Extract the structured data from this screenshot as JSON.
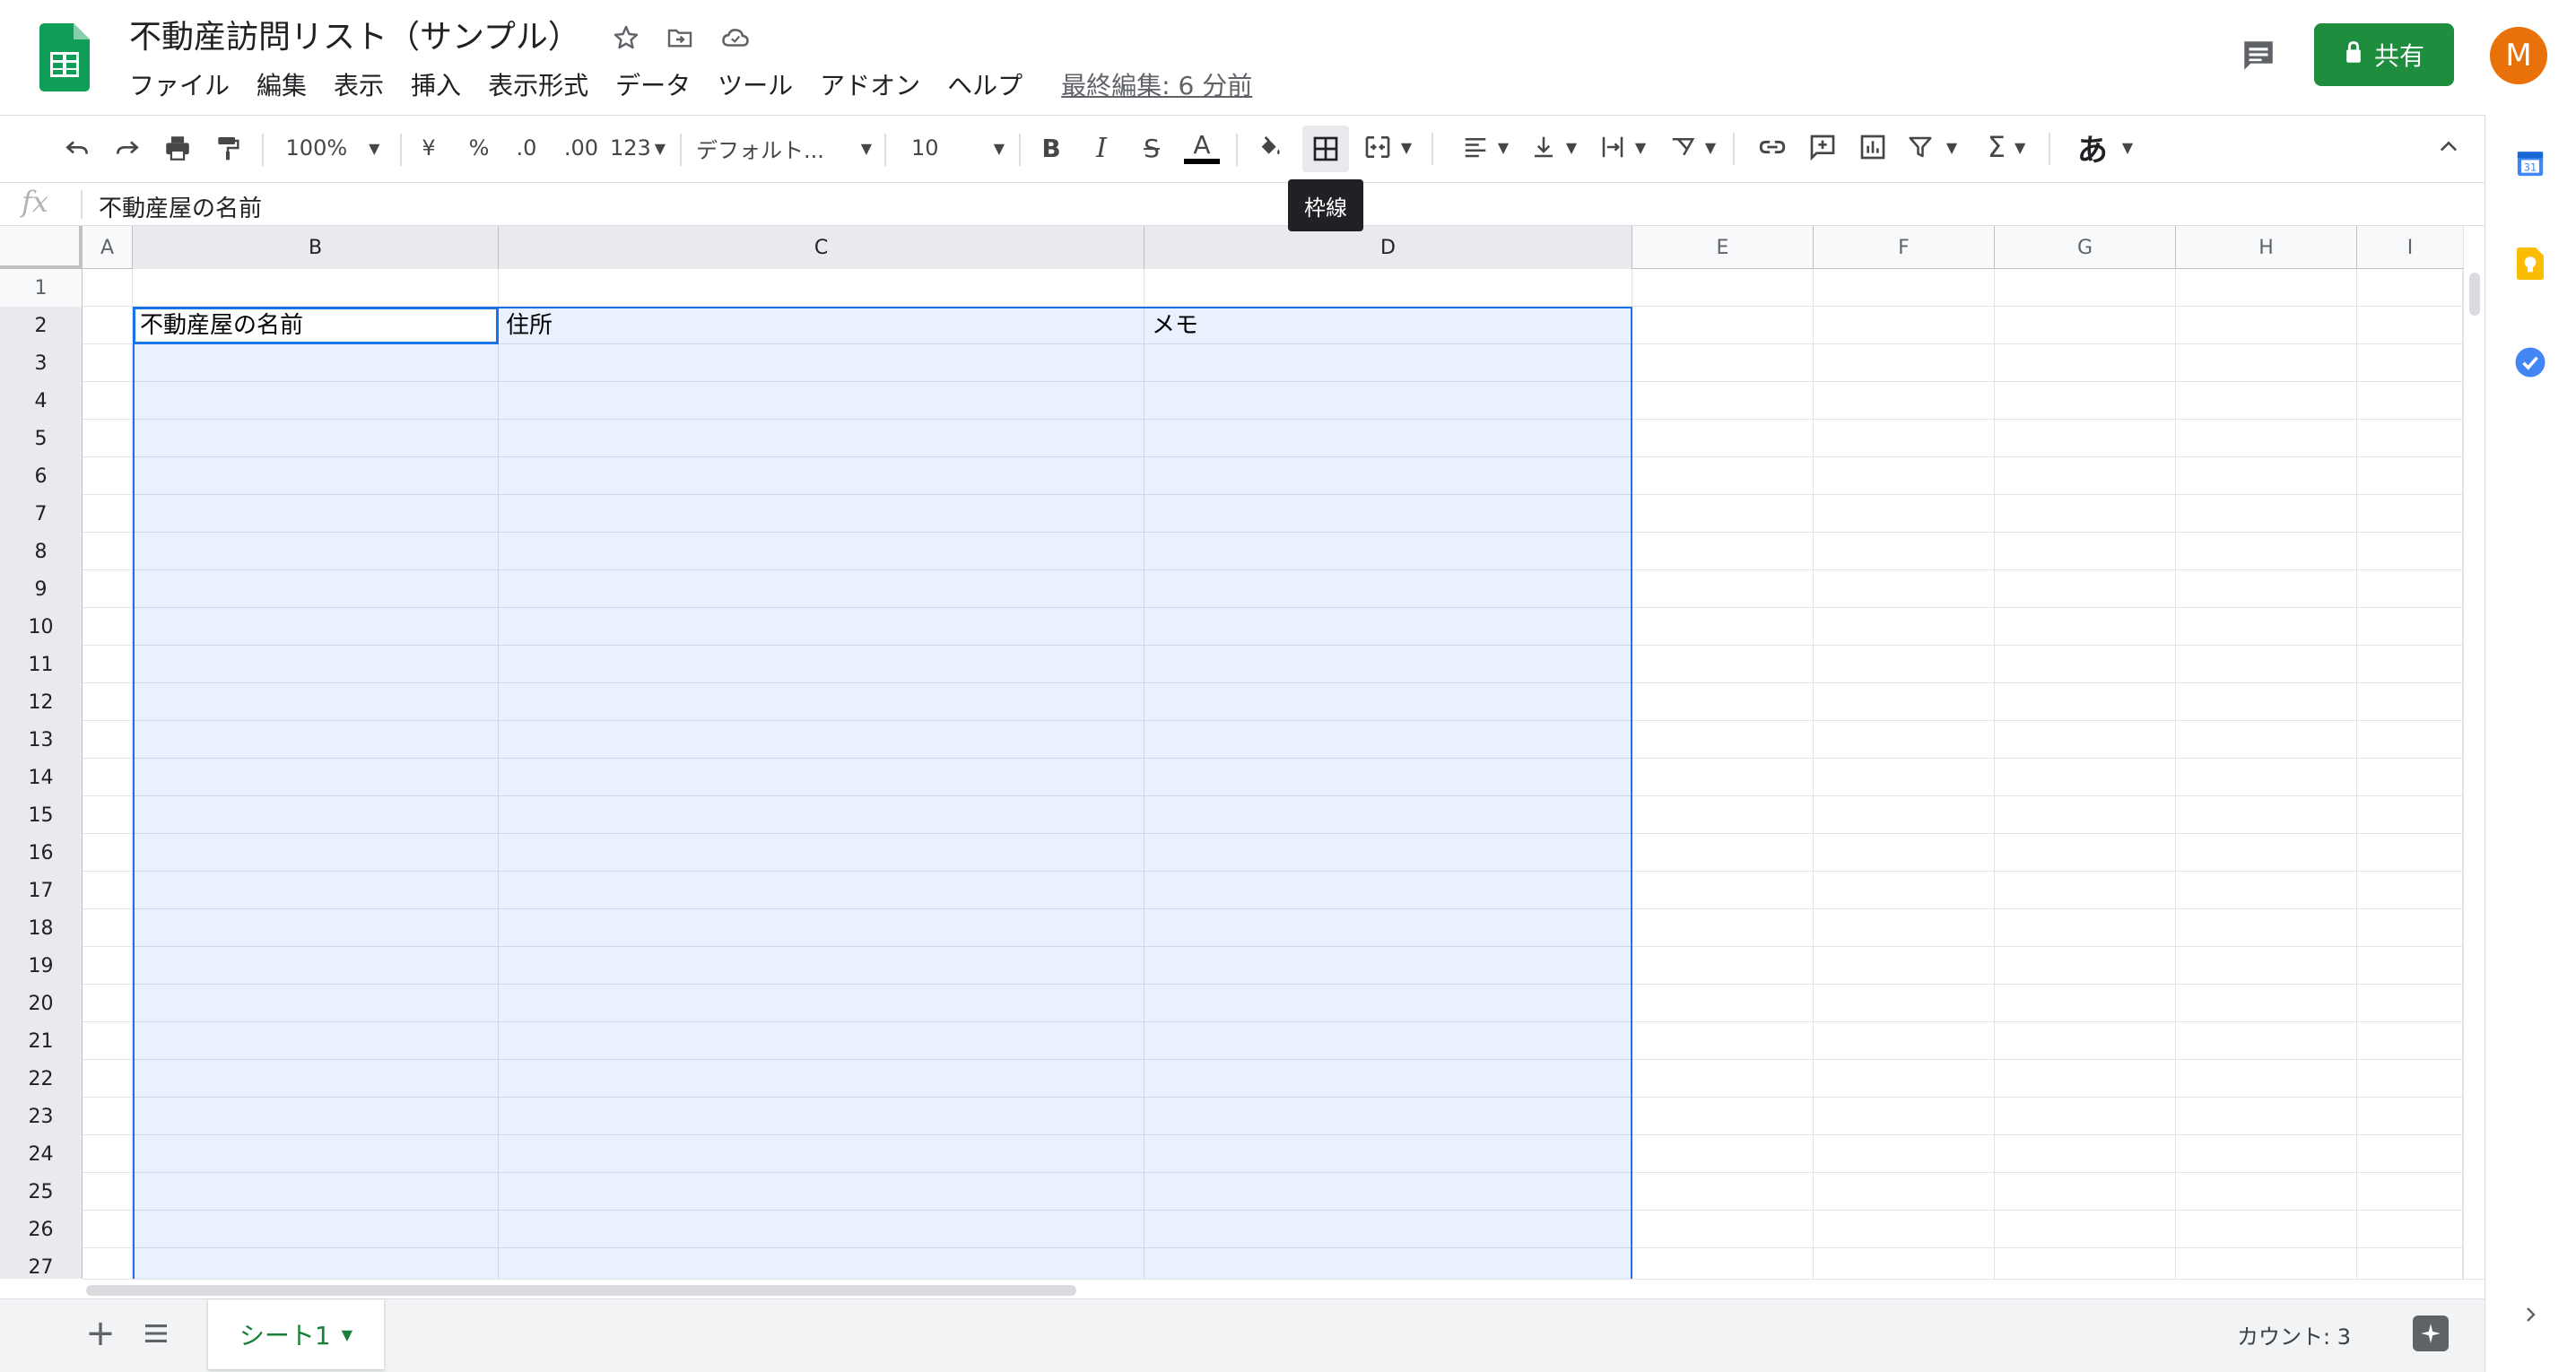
{
  "header": {
    "title": "不動産訪問リスト（サンプル）",
    "menu": [
      "ファイル",
      "編集",
      "表示",
      "挿入",
      "表示形式",
      "データ",
      "ツール",
      "アドオン",
      "ヘルプ"
    ],
    "last_edit": "最終編集: 6 分前",
    "share_label": "共有",
    "avatar_initial": "M",
    "icons": [
      "star-icon",
      "move-to-folder-icon",
      "cloud-status-icon",
      "comments-icon"
    ]
  },
  "toolbar": {
    "zoom": "100%",
    "currency": "¥",
    "percent": "%",
    "decrease_decimal": ".0",
    "increase_decimal": ".00",
    "more_formats": "123",
    "font": "デフォルト...",
    "font_size": "10",
    "bold": "B",
    "italic": "I",
    "strikethrough": "S",
    "text_color": "A",
    "input_tools": "あ",
    "tooltip": "枠線"
  },
  "formula_bar": {
    "fx": "fx",
    "content": "不動産屋の名前"
  },
  "grid": {
    "columns": [
      "A",
      "B",
      "C",
      "D",
      "E",
      "F",
      "G",
      "H",
      "I"
    ],
    "rows": [
      "1",
      "2",
      "3",
      "4",
      "5",
      "6",
      "7",
      "8",
      "9",
      "10",
      "11",
      "12",
      "13",
      "14",
      "15",
      "16",
      "17",
      "18",
      "19",
      "20",
      "21",
      "22",
      "23",
      "24",
      "25",
      "26",
      "27"
    ],
    "cells": {
      "B2": "不動産屋の名前",
      "C2": "住所",
      "D2": "メモ"
    },
    "selection": "B2:D27",
    "active_cell": "B2"
  },
  "bottom": {
    "sheet_name": "シート1",
    "count_label": "カウント: 3"
  },
  "colors": {
    "share_green": "#1e8e3e",
    "avatar_orange": "#e8710a",
    "selection_blue": "#1a73e8",
    "sheet_tab_green": "#188038"
  }
}
